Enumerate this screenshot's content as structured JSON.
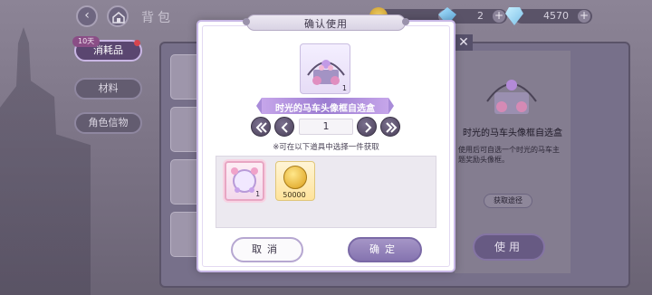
{
  "background": {
    "header_title": "背包",
    "currencies": [
      {
        "icon": "coin-icon",
        "value": ""
      },
      {
        "icon": "gem-icon",
        "value": "2"
      },
      {
        "icon": "diamond-icon",
        "value": "4570"
      }
    ],
    "sidebar": {
      "badge": "10天",
      "items": [
        {
          "label": "消耗品",
          "active": true
        },
        {
          "label": "材料",
          "active": false
        },
        {
          "label": "角色信物",
          "active": false
        }
      ]
    },
    "detail": {
      "item_name": "时光的马车头像框自选盒",
      "description": "使用后可自选一个时光的马车主题奖励头像框。",
      "get_path_label": "获取途径",
      "use_label": "使用"
    }
  },
  "dialog": {
    "title": "确认使用",
    "item": {
      "name": "时光的马车头像框自选盒",
      "count": "1"
    },
    "quantity": {
      "value": "1"
    },
    "note": "※可在以下道具中选择一件获取",
    "options": [
      {
        "name": "frame-option",
        "count": "1",
        "selected": true
      },
      {
        "name": "coin-option",
        "count": "50000",
        "selected": false
      }
    ],
    "cancel_label": "取消",
    "confirm_label": "确定"
  },
  "colors": {
    "accent": "#8574b0",
    "ribbon": "#9c7dd2",
    "selected_border": "#e8a6c3"
  }
}
